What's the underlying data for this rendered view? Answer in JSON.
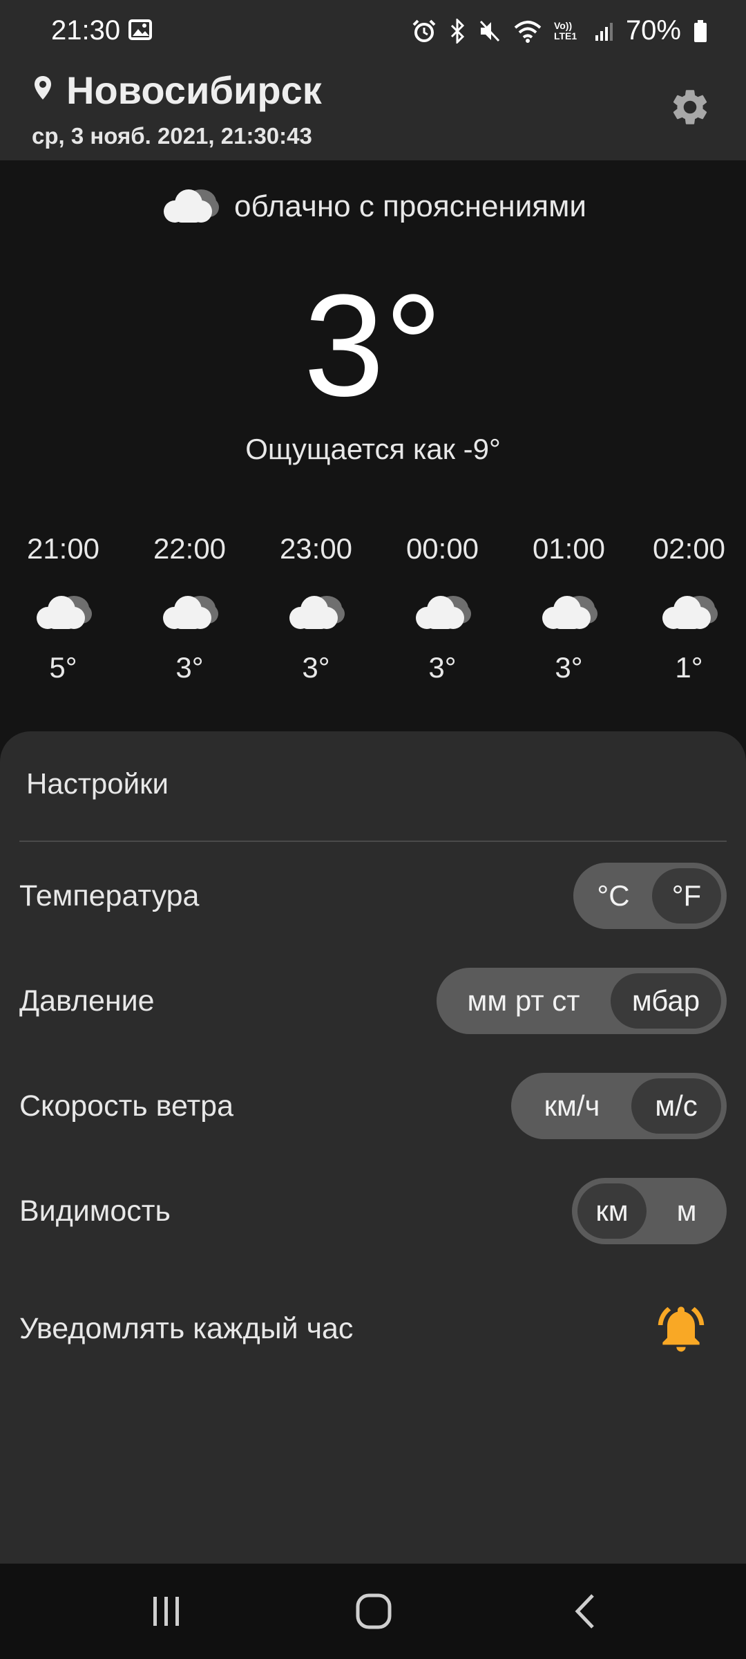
{
  "status_bar": {
    "time": "21:30",
    "network_label": "Vo)) LTE1",
    "battery": "70%"
  },
  "header": {
    "city": "Новосибирск",
    "datetime": "ср, 3 нояб. 2021, 21:30:43"
  },
  "current": {
    "condition": "облачно с прояснениями",
    "temperature": "3°",
    "feels_like": "Ощущается как -9°"
  },
  "hourly": [
    {
      "time": "21:00",
      "temp": "5°",
      "icon": "cloud-icon"
    },
    {
      "time": "22:00",
      "temp": "3°",
      "icon": "cloud-icon"
    },
    {
      "time": "23:00",
      "temp": "3°",
      "icon": "cloud-icon"
    },
    {
      "time": "00:00",
      "temp": "3°",
      "icon": "cloud-icon"
    },
    {
      "time": "01:00",
      "temp": "3°",
      "icon": "cloud-icon"
    },
    {
      "time": "02:00",
      "temp": "1°",
      "icon": "cloud-icon"
    }
  ],
  "settings": {
    "title": "Настройки",
    "temperature": {
      "label": "Температура",
      "options": [
        "°C",
        "°F"
      ],
      "selected": "°F"
    },
    "pressure": {
      "label": "Давление",
      "options": [
        "мм рт ст",
        "мбар"
      ],
      "selected": "мбар"
    },
    "wind": {
      "label": "Скорость ветра",
      "options": [
        "км/ч",
        "м/с"
      ],
      "selected": "м/с"
    },
    "visibility": {
      "label": "Видимость",
      "options": [
        "км",
        "м"
      ],
      "selected": "км"
    },
    "notify": {
      "label": "Уведомлять каждый час",
      "icon": "bell-icon",
      "enabled": true
    }
  },
  "colors": {
    "bell_accent": "#f9a825",
    "background": "#141414",
    "sheet": "#2c2c2c",
    "segment": "#5b5b5b",
    "segment_selected": "#3a3a3a"
  }
}
